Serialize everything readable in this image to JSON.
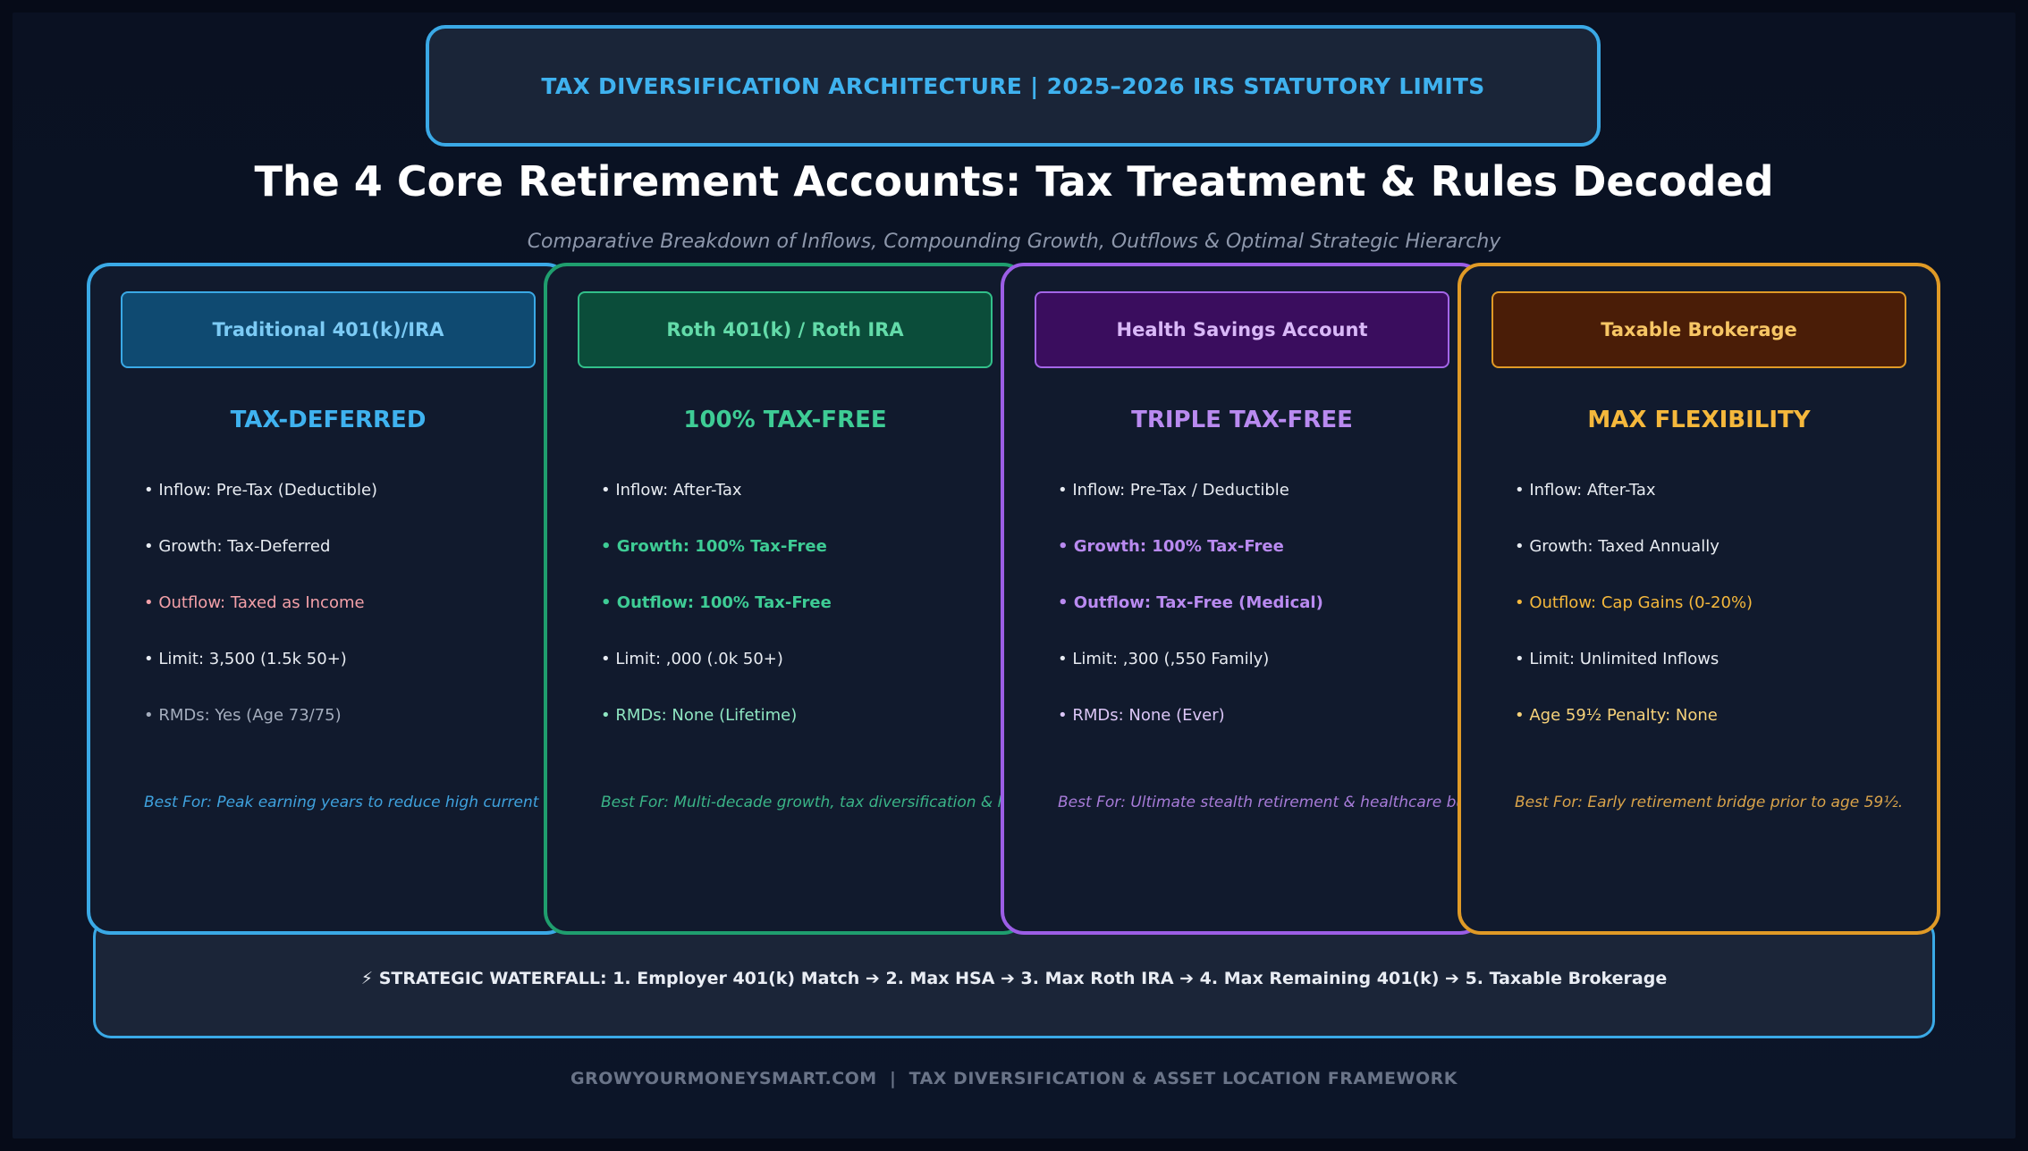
{
  "banner": "TAX DIVERSIFICATION ARCHITECTURE | 2025–2026 IRS STATUTORY LIMITS",
  "title": "The 4 Core Retirement Accounts: Tax Treatment & Rules Decoded",
  "subtitle": "Comparative Breakdown of Inflows, Compounding Growth, Outflows & Optimal Strategic Hierarchy",
  "cards": [
    {
      "name": "Traditional 401(k)/IRA",
      "tag": "TAX-DEFERRED",
      "colors": {
        "border": "#3aa9e6",
        "header_bg": "#0f4a71",
        "header_border": "#3aa9e6",
        "header_text": "#7ccbf5",
        "tag": "#3fb2ef",
        "best": "#3fa2de"
      },
      "rows": [
        {
          "text": "• Inflow: Pre-Tax (Deductible)",
          "color": "#e8ecf2",
          "bold": false
        },
        {
          "text": "• Growth: Tax-Deferred",
          "color": "#e8ecf2",
          "bold": false
        },
        {
          "text": "• Outflow: Taxed as Income",
          "color": "#f3a0a8",
          "bold": false
        },
        {
          "text": "• Limit: 3,500 (1.5k 50+)",
          "color": "#e8ecf2",
          "bold": false
        },
        {
          "text": "• RMDs: Yes (Age 73/75)",
          "color": "#a4adbd",
          "bold": false
        }
      ],
      "best": "Best For: Peak earning years to reduce high current tax brackets."
    },
    {
      "name": "Roth 401(k) / Roth IRA",
      "tag": "100% TAX-FREE",
      "colors": {
        "border": "#1f9e6e",
        "header_bg": "#0b4d3a",
        "header_border": "#32c08a",
        "header_text": "#63dba9",
        "tag": "#3ecc95",
        "best": "#3ab487"
      },
      "rows": [
        {
          "text": "• Inflow: After-Tax",
          "color": "#e8ecf2",
          "bold": false
        },
        {
          "text": "• Growth: 100% Tax-Free",
          "color": "#3ecc95",
          "bold": true
        },
        {
          "text": "• Outflow: 100% Tax-Free",
          "color": "#3ecc95",
          "bold": true
        },
        {
          "text": "• Limit: ,000 (.0k 50+)",
          "color": "#e8ecf2",
          "bold": false
        },
        {
          "text": "• RMDs: None (Lifetime)",
          "color": "#8fe6c2",
          "bold": false
        }
      ],
      "best": "Best For: Multi-decade growth, tax diversification & heirs."
    },
    {
      "name": "Health Savings Account",
      "tag": "TRIPLE TAX-FREE",
      "colors": {
        "border": "#9c5ee6",
        "header_bg": "#3a0d5e",
        "header_border": "#a466e8",
        "header_text": "#d9b8f8",
        "tag": "#b98af0",
        "best": "#a77bd8"
      },
      "rows": [
        {
          "text": "• Inflow: Pre-Tax / Deductible",
          "color": "#e8ecf2",
          "bold": false
        },
        {
          "text": "• Growth: 100% Tax-Free",
          "color": "#b98af0",
          "bold": true
        },
        {
          "text": "• Outflow: Tax-Free (Medical)",
          "color": "#b98af0",
          "bold": true
        },
        {
          "text": "• Limit: ,300 (,550 Family)",
          "color": "#e8ecf2",
          "bold": false
        },
        {
          "text": "• RMDs: None (Ever)",
          "color": "#dcc6f7",
          "bold": false
        }
      ],
      "best": "Best For: Ultimate stealth retirement & healthcare buffer."
    },
    {
      "name": "Taxable Brokerage",
      "tag": "MAX FLEXIBILITY",
      "colors": {
        "border": "#e09a26",
        "header_bg": "#4a1d07",
        "header_border": "#e09a26",
        "header_text": "#f7c665",
        "tag": "#f5b83c",
        "best": "#d9a34a"
      },
      "rows": [
        {
          "text": "• Inflow: After-Tax",
          "color": "#e8ecf2",
          "bold": false
        },
        {
          "text": "• Growth: Taxed Annually",
          "color": "#e8ecf2",
          "bold": false
        },
        {
          "text": "• Outflow: Cap Gains (0-20%)",
          "color": "#f5b83c",
          "bold": false
        },
        {
          "text": "• Limit: Unlimited Inflows",
          "color": "#e8ecf2",
          "bold": false
        },
        {
          "text": "• Age 59½ Penalty: None",
          "color": "#f7d27a",
          "bold": false
        }
      ],
      "best": "Best For: Early retirement bridge prior to age 59½."
    }
  ],
  "waterfall": "⚡ STRATEGIC WATERFALL: 1. Employer 401(k) Match ➔ 2. Max HSA ➔ 3. Max Roth IRA ➔ 4. Max Remaining 401(k) ➔ 5. Taxable Brokerage",
  "footer": "GROWYOURMONEYSMART.COM  |  TAX DIVERSIFICATION & ASSET LOCATION FRAMEWORK"
}
